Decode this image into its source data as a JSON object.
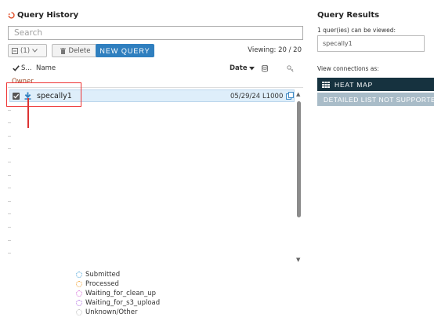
{
  "query_history": {
    "title": "Query History",
    "search_placeholder": "Search",
    "toolbar": {
      "selection_count": "(1)",
      "delete_label": "Delete",
      "new_query_label": "NEW QUERY",
      "viewing": "Viewing: 20 / 20"
    },
    "columns": {
      "status": "S...",
      "name": "Name",
      "date": "Date"
    },
    "group_label": "Owner",
    "rows": [
      {
        "name": "specally1",
        "date": "05/29/24",
        "limit": "L1000",
        "checked": true
      }
    ],
    "legend": [
      {
        "label": "Submitted",
        "color": "#4aa3d8"
      },
      {
        "label": "Processed",
        "color": "#f0a030"
      },
      {
        "label": "Waiting_for_clean_up",
        "color": "#d66bd8"
      },
      {
        "label": "Waiting_for_s3_upload",
        "color": "#b06ee0"
      },
      {
        "label": "Unknown/Other",
        "color": "#bbbbbb"
      }
    ]
  },
  "query_results": {
    "title": "Query Results",
    "viewable_text": "1 quer(ies) can be viewed:",
    "selected_query": "specally1",
    "view_as_label": "View connections as:",
    "heat_map_label": "HEAT MAP",
    "detailed_list_label": "DETAILED LIST NOT SUPPORTED"
  },
  "colors": {
    "accent": "#2f7fbf",
    "title_icon": "#e0502a",
    "heat_map_bg": "#16323f",
    "disabled_bg": "#a9bcc8",
    "annotation": "#e33333"
  }
}
